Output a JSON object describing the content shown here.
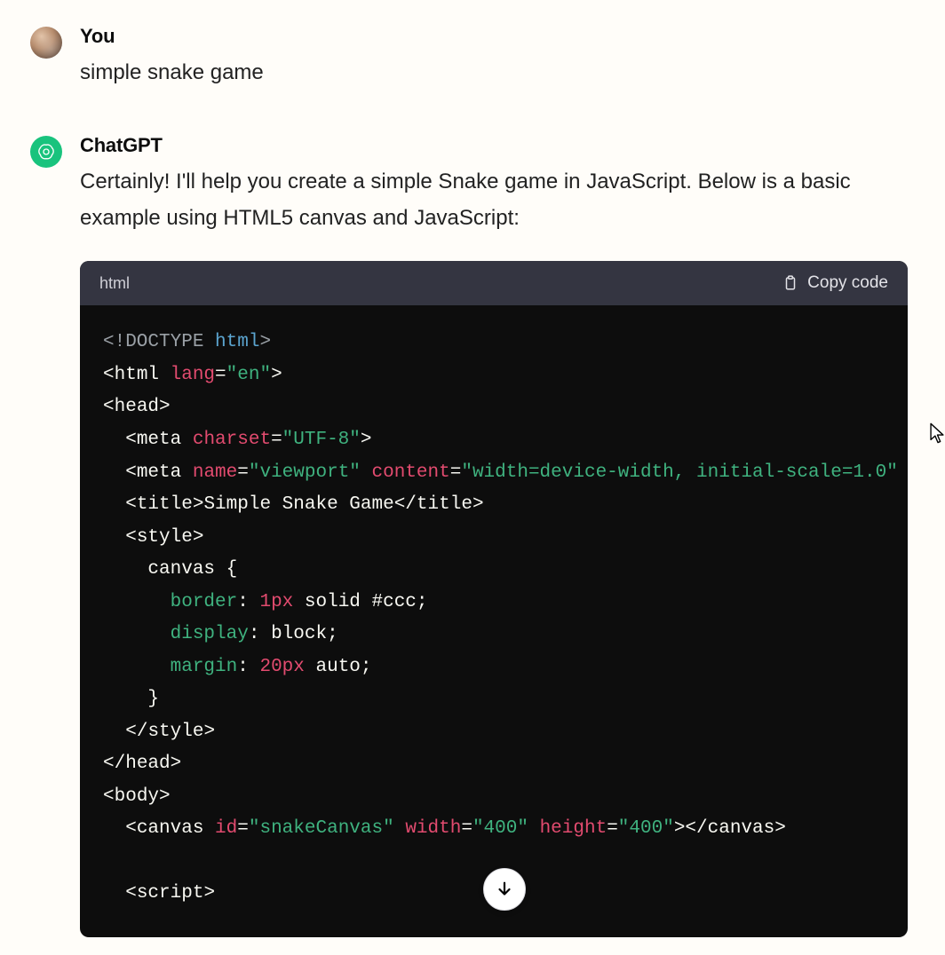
{
  "user": {
    "name": "You",
    "message": "simple snake game"
  },
  "assistant": {
    "name": "ChatGPT",
    "intro": "Certainly! I'll help you create a simple Snake game in JavaScript. Below is a basic example using HTML5 canvas and JavaScript:",
    "code_language": "html",
    "copy_label": "Copy code",
    "code_tokens": [
      [
        [
          "doctype",
          "<!DOCTYPE "
        ],
        [
          "name",
          "html"
        ],
        [
          "doctype",
          ">"
        ]
      ],
      [
        [
          "punct",
          "<"
        ],
        [
          "tag",
          "html "
        ],
        [
          "attr",
          "lang"
        ],
        [
          "punct",
          "="
        ],
        [
          "str",
          "\"en\""
        ],
        [
          "punct",
          ">"
        ]
      ],
      [
        [
          "punct",
          "<"
        ],
        [
          "tag",
          "head"
        ],
        [
          "punct",
          ">"
        ]
      ],
      [
        [
          "text",
          "  "
        ],
        [
          "punct",
          "<"
        ],
        [
          "tag",
          "meta "
        ],
        [
          "attr",
          "charset"
        ],
        [
          "punct",
          "="
        ],
        [
          "str",
          "\"UTF-8\""
        ],
        [
          "punct",
          ">"
        ]
      ],
      [
        [
          "text",
          "  "
        ],
        [
          "punct",
          "<"
        ],
        [
          "tag",
          "meta "
        ],
        [
          "attr",
          "name"
        ],
        [
          "punct",
          "="
        ],
        [
          "str",
          "\"viewport\""
        ],
        [
          "text",
          " "
        ],
        [
          "attr",
          "content"
        ],
        [
          "punct",
          "="
        ],
        [
          "str",
          "\"width=device-width, initial-scale=1.0\""
        ]
      ],
      [
        [
          "text",
          "  "
        ],
        [
          "punct",
          "<"
        ],
        [
          "tag",
          "title"
        ],
        [
          "punct",
          ">"
        ],
        [
          "text",
          "Simple Snake Game"
        ],
        [
          "punct",
          "</"
        ],
        [
          "tag",
          "title"
        ],
        [
          "punct",
          ">"
        ]
      ],
      [
        [
          "text",
          "  "
        ],
        [
          "punct",
          "<"
        ],
        [
          "tag",
          "style"
        ],
        [
          "punct",
          ">"
        ]
      ],
      [
        [
          "text",
          "    canvas {"
        ]
      ],
      [
        [
          "text",
          "      "
        ],
        [
          "cssprop",
          "border"
        ],
        [
          "punct",
          ": "
        ],
        [
          "cssnum",
          "1px"
        ],
        [
          "text",
          " solid "
        ],
        [
          "cssval",
          "#ccc"
        ],
        [
          "punct",
          ";"
        ]
      ],
      [
        [
          "text",
          "      "
        ],
        [
          "cssprop",
          "display"
        ],
        [
          "punct",
          ": "
        ],
        [
          "cssval",
          "block"
        ],
        [
          "punct",
          ";"
        ]
      ],
      [
        [
          "text",
          "      "
        ],
        [
          "cssprop",
          "margin"
        ],
        [
          "punct",
          ": "
        ],
        [
          "cssnum",
          "20px"
        ],
        [
          "text",
          " auto"
        ],
        [
          "punct",
          ";"
        ]
      ],
      [
        [
          "text",
          "    }"
        ]
      ],
      [
        [
          "text",
          "  "
        ],
        [
          "punct",
          "</"
        ],
        [
          "tag",
          "style"
        ],
        [
          "punct",
          ">"
        ]
      ],
      [
        [
          "punct",
          "</"
        ],
        [
          "tag",
          "head"
        ],
        [
          "punct",
          ">"
        ]
      ],
      [
        [
          "punct",
          "<"
        ],
        [
          "tag",
          "body"
        ],
        [
          "punct",
          ">"
        ]
      ],
      [
        [
          "text",
          "  "
        ],
        [
          "punct",
          "<"
        ],
        [
          "tag",
          "canvas "
        ],
        [
          "attr",
          "id"
        ],
        [
          "punct",
          "="
        ],
        [
          "str",
          "\"snakeCanvas\""
        ],
        [
          "text",
          " "
        ],
        [
          "attr",
          "width"
        ],
        [
          "punct",
          "="
        ],
        [
          "str",
          "\"400\""
        ],
        [
          "text",
          " "
        ],
        [
          "attr",
          "height"
        ],
        [
          "punct",
          "="
        ],
        [
          "str",
          "\"400\""
        ],
        [
          "punct",
          "></"
        ],
        [
          "tag",
          "canvas"
        ],
        [
          "punct",
          ">"
        ]
      ],
      [
        [
          "text",
          ""
        ]
      ],
      [
        [
          "text",
          "  "
        ],
        [
          "punct",
          "<"
        ],
        [
          "tag",
          "script"
        ],
        [
          "punct",
          ">"
        ]
      ]
    ]
  },
  "colors": {
    "accent_green": "#19c37d",
    "code_bg": "#0d0d0d",
    "bar_bg": "#343541"
  }
}
